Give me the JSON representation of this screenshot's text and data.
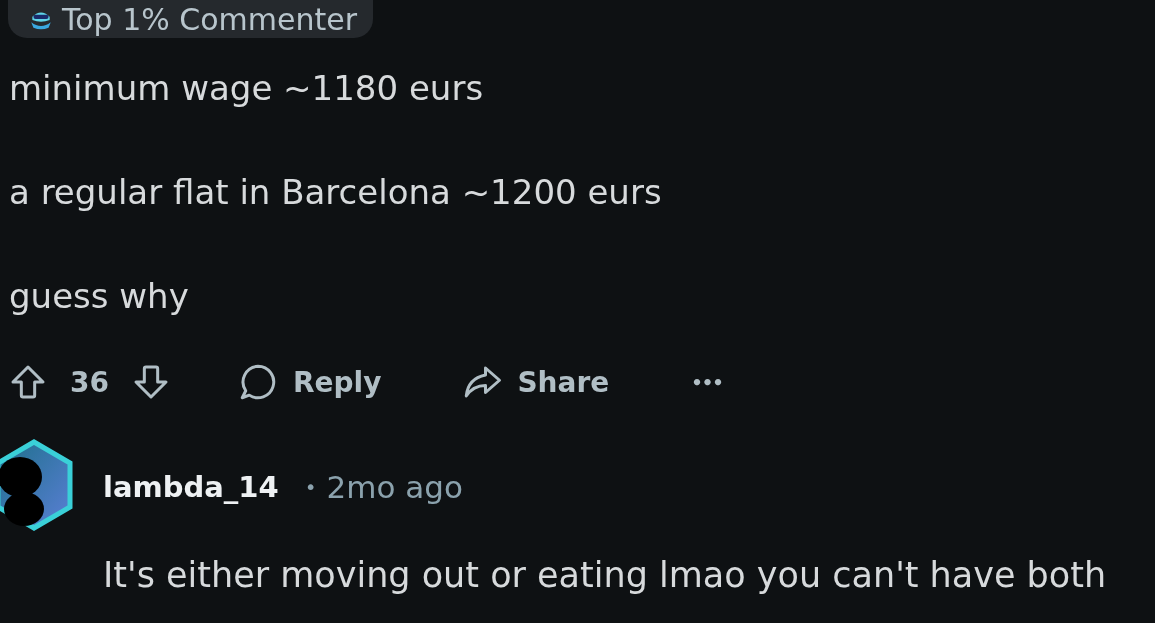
{
  "comment": {
    "badge": "Top 1% Commenter",
    "paragraphs": [
      "minimum wage ~1180 eurs",
      "a regular flat in Barcelona ~1200 eurs",
      "guess why"
    ],
    "actions": {
      "score": "36",
      "reply": "Reply",
      "share": "Share",
      "more": "•••"
    }
  },
  "reply": {
    "username": "lambda_14",
    "separator": "•",
    "time": "2mo ago",
    "body": "It's either moving out or eating lmao you can't have both"
  }
}
